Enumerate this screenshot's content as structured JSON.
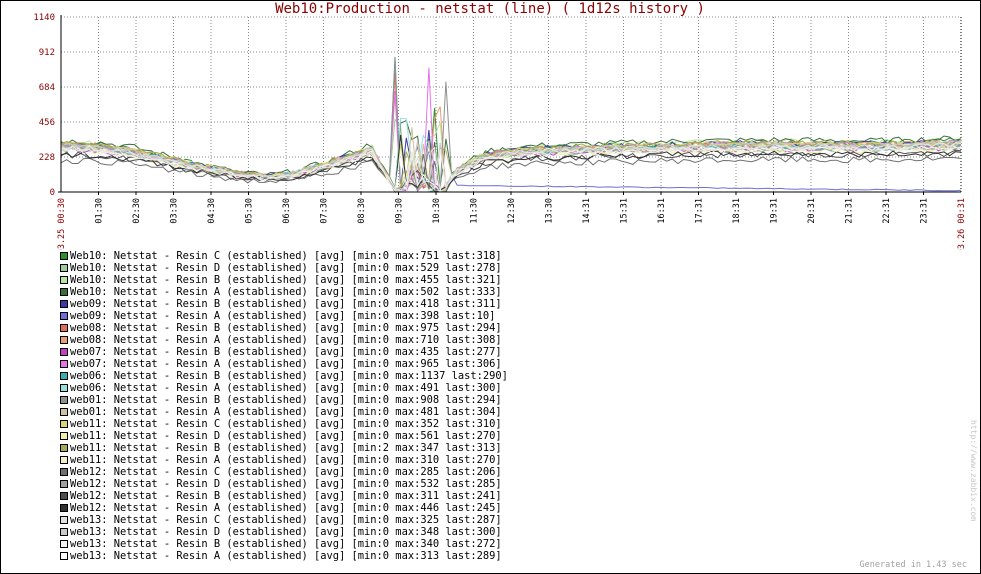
{
  "chart_data": {
    "type": "line",
    "title": "Web10:Production - netstat (line) ( 1d12s history )",
    "ylim": [
      0,
      1140
    ],
    "yticks": [
      "0",
      "228",
      "456",
      "684",
      "912",
      "1140"
    ],
    "x_start_label": "03.25 00:30",
    "x_end_label": "03.26 00:31",
    "x_tick_labels": [
      "01:30",
      "02:30",
      "03:30",
      "04:30",
      "05:30",
      "06:30",
      "07:30",
      "08:30",
      "09:30",
      "10:30",
      "11:30",
      "12:30",
      "13:30",
      "14:31",
      "15:31",
      "16:31",
      "17:31",
      "18:31",
      "19:31",
      "20:31",
      "21:31",
      "22:31",
      "23:31"
    ],
    "grid": true,
    "legend_position": "below",
    "series": [
      {
        "name": "Web10: Netstat - Resin C (established) [avg]",
        "min": 0,
        "max": 751,
        "last": 318,
        "color": "#2f8f2f"
      },
      {
        "name": "Web10: Netstat - Resin D (established) [avg]",
        "min": 0,
        "max": 529,
        "last": 278,
        "color": "#9acd9a"
      },
      {
        "name": "Web10: Netstat - Resin B (established) [avg]",
        "min": 0,
        "max": 455,
        "last": 321,
        "color": "#b8e6a0"
      },
      {
        "name": "Web10: Netstat - Resin A (established) [avg]",
        "min": 0,
        "max": 502,
        "last": 333,
        "color": "#3c6e3c"
      },
      {
        "name": "web09: Netstat - Resin B (established) [avg]",
        "min": 0,
        "max": 418,
        "last": 311,
        "color": "#3a3aa8"
      },
      {
        "name": "web09: Netstat - Resin A (established) [avg]",
        "min": 0,
        "max": 398,
        "last": 10,
        "color": "#6f6fd6"
      },
      {
        "name": "web08: Netstat - Resin B (established) [avg]",
        "min": 0,
        "max": 975,
        "last": 294,
        "color": "#e07050"
      },
      {
        "name": "web08: Netstat - Resin A (established) [avg]",
        "min": 0,
        "max": 710,
        "last": 308,
        "color": "#e8a070"
      },
      {
        "name": "web07: Netstat - Resin B (established) [avg]",
        "min": 0,
        "max": 435,
        "last": 277,
        "color": "#c040c0"
      },
      {
        "name": "web07: Netstat - Resin A (established) [avg]",
        "min": 0,
        "max": 965,
        "last": 306,
        "color": "#e870e8"
      },
      {
        "name": "web06: Netstat - Resin B (established) [avg]",
        "min": 0,
        "max": 1137,
        "last": 290,
        "color": "#30b0b0"
      },
      {
        "name": "web06: Netstat - Resin A (established) [avg]",
        "min": 0,
        "max": 491,
        "last": 300,
        "color": "#90e0e0"
      },
      {
        "name": "web01: Netstat - Resin B (established) [avg]",
        "min": 0,
        "max": 908,
        "last": 294,
        "color": "#909090"
      },
      {
        "name": "web01: Netstat - Resin A (established) [avg]",
        "min": 0,
        "max": 481,
        "last": 304,
        "color": "#d0c0a0"
      },
      {
        "name": "web11: Netstat - Resin C (established) [avg]",
        "min": 0,
        "max": 352,
        "last": 310,
        "color": "#d8d870"
      },
      {
        "name": "web11: Netstat - Resin D (established) [avg]",
        "min": 0,
        "max": 561,
        "last": 270,
        "color": "#f0f0a0"
      },
      {
        "name": "web11: Netstat - Resin B (established) [avg]",
        "min": 2,
        "max": 347,
        "last": 313,
        "color": "#a8a850"
      },
      {
        "name": "web11: Netstat - Resin A (established) [avg]",
        "min": 0,
        "max": 310,
        "last": 270,
        "color": "#f0f0c8"
      },
      {
        "name": "Web12: Netstat - Resin C (established) [avg]",
        "min": 0,
        "max": 285,
        "last": 206,
        "color": "#707070"
      },
      {
        "name": "Web12: Netstat - Resin D (established) [avg]",
        "min": 0,
        "max": 532,
        "last": 285,
        "color": "#a0a0a0"
      },
      {
        "name": "Web12: Netstat - Resin B (established) [avg]",
        "min": 0,
        "max": 311,
        "last": 241,
        "color": "#505050"
      },
      {
        "name": "Web12: Netstat - Resin A (established) [avg]",
        "min": 0,
        "max": 446,
        "last": 245,
        "color": "#303030"
      },
      {
        "name": "web13: Netstat - Resin C (established) [avg]",
        "min": 0,
        "max": 325,
        "last": 287,
        "color": "#e0e0e0"
      },
      {
        "name": "web13: Netstat - Resin D (established) [avg]",
        "min": 0,
        "max": 348,
        "last": 300,
        "color": "#c8c8c8"
      },
      {
        "name": "web13: Netstat - Resin B (established) [avg]",
        "min": 0,
        "max": 340,
        "last": 272,
        "color": "#f4f4f4"
      },
      {
        "name": "web13: Netstat - Resin A (established) [avg]",
        "min": 0,
        "max": 313,
        "last": 289,
        "color": "#ffffff"
      }
    ]
  },
  "footer": {
    "generated": "Generated in 1.43 sec",
    "watermark": "http://www.zabbix.com"
  }
}
